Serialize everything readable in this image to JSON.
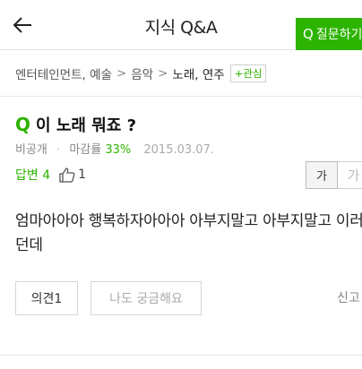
{
  "header": {
    "title": "지식 Q&A",
    "ask_button_label": "질문하기"
  },
  "breadcrumb": {
    "items": [
      "엔터테인먼트, 예술",
      "음악",
      "노래, 연주"
    ],
    "follow_label": "+관심"
  },
  "question": {
    "title": "이 노래 뭐죠 ?",
    "visibility": "비공개",
    "deadline_label": "마감률",
    "deadline_rate": "33%",
    "date": "2015.03.07.",
    "answers_label": "답변 4",
    "likes": "1",
    "body": "엄마아아아 행복하자아아아 아부지말고 아부지말고 이러던데"
  },
  "font_size": {
    "small_label": "가",
    "large_label": "가"
  },
  "actions": {
    "opinion_label": "의견1",
    "curious_label": "나도 궁금해요",
    "report_label": "신고"
  },
  "colors": {
    "accent": "#2db400"
  }
}
